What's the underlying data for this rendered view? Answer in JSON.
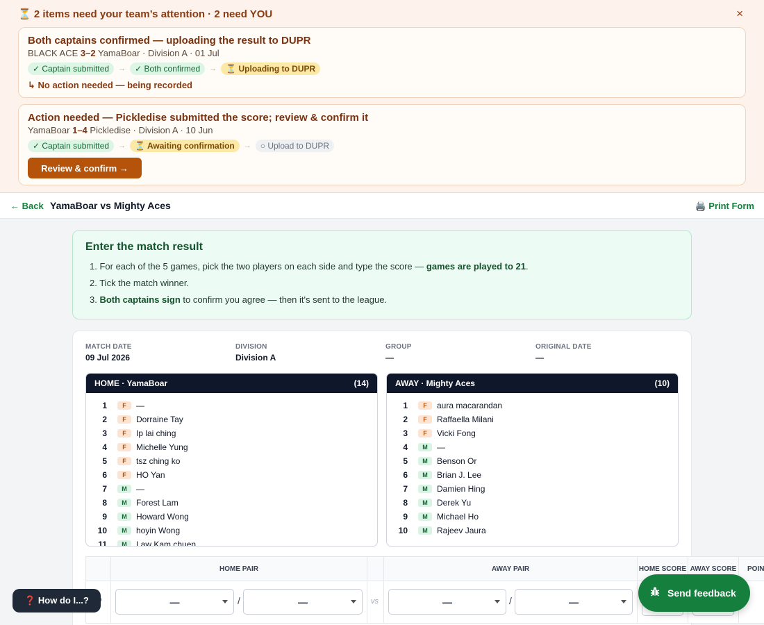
{
  "attention": {
    "heading": "⏳ 2 items need your team’s attention · 2 need YOU",
    "close": "×",
    "card1": {
      "title": "Both captains confirmed — uploading the result to DUPR",
      "home": "BLACK ACE",
      "score": "3–2",
      "rest": "YamaBoar · Division A · 01 Jul",
      "steps": [
        "✓ Captain submitted",
        "✓ Both confirmed",
        "⏳ Uploading to DUPR"
      ],
      "note": "↳ No action needed — being recorded"
    },
    "card2": {
      "title": "Action needed — Pickledise submitted the score; review & confirm it",
      "home": "YamaBoar",
      "score": "1–4",
      "rest": "Pickledise · Division A · 10 Jun",
      "steps": [
        "✓ Captain submitted",
        "⏳ Awaiting confirmation",
        "○ Upload to DUPR"
      ],
      "button": "Review & confirm →"
    },
    "arrow": "→"
  },
  "header": {
    "back": "← Back",
    "title": "YamaBoar vs Mighty Aces",
    "print": "🖨️ Print Form"
  },
  "instructions": {
    "title": "Enter the match result",
    "step1_pre": "1. For each of the 5 games, pick the two players on each side and type the score — ",
    "step1_bold": "games are played to 21",
    "step1_post": ".",
    "step2": "2. Tick the match winner.",
    "step3_bold": "Both captains sign",
    "step3_pre": "3. ",
    "step3_post": " to confirm you agree — then it's sent to the league."
  },
  "meta": {
    "match_date_label": "MATCH DATE",
    "match_date": "09 Jul 2026",
    "division_label": "DIVISION",
    "division": "Division A",
    "group_label": "GROUP",
    "group": "—",
    "original_date_label": "ORIGINAL DATE",
    "original_date": "—"
  },
  "home": {
    "label": "HOME · YamaBoar",
    "count": "(14)",
    "players": [
      {
        "n": "1",
        "g": "F",
        "name": "—"
      },
      {
        "n": "2",
        "g": "F",
        "name": "Dorraine Tay"
      },
      {
        "n": "3",
        "g": "F",
        "name": "Ip lai ching"
      },
      {
        "n": "4",
        "g": "F",
        "name": "Michelle Yung"
      },
      {
        "n": "5",
        "g": "F",
        "name": "tsz ching ko"
      },
      {
        "n": "6",
        "g": "F",
        "name": "HO Yan"
      },
      {
        "n": "7",
        "g": "M",
        "name": "—"
      },
      {
        "n": "8",
        "g": "M",
        "name": "Forest Lam"
      },
      {
        "n": "9",
        "g": "M",
        "name": "Howard Wong"
      },
      {
        "n": "10",
        "g": "M",
        "name": "hoyin Wong"
      },
      {
        "n": "11",
        "g": "M",
        "name": "Law Kam chuen"
      }
    ]
  },
  "away": {
    "label": "AWAY · Mighty Aces",
    "count": "(10)",
    "players": [
      {
        "n": "1",
        "g": "F",
        "name": "aura macarandan"
      },
      {
        "n": "2",
        "g": "F",
        "name": "Raffaella Milani"
      },
      {
        "n": "3",
        "g": "F",
        "name": "Vicki Fong"
      },
      {
        "n": "4",
        "g": "M",
        "name": "—"
      },
      {
        "n": "5",
        "g": "M",
        "name": "Benson Or"
      },
      {
        "n": "6",
        "g": "M",
        "name": "Brian J. Lee"
      },
      {
        "n": "7",
        "g": "M",
        "name": "Damien Hing"
      },
      {
        "n": "8",
        "g": "M",
        "name": "Derek Yu"
      },
      {
        "n": "9",
        "g": "M",
        "name": "Michael Ho"
      },
      {
        "n": "10",
        "g": "M",
        "name": "Rajeev Jaura"
      }
    ]
  },
  "games": {
    "home_pair": "HOME PAIR",
    "away_pair": "AWAY PAIR",
    "home_score": "HOME SCORE",
    "away_score": "AWAY SCORE",
    "points": "POIN",
    "row_label": "D",
    "empty": "—",
    "slash": "/",
    "vs": "vs"
  },
  "fab": {
    "help": "❓ How do I...?",
    "feedback": "Send feedback",
    "feedback_icon": "bug-icon"
  }
}
